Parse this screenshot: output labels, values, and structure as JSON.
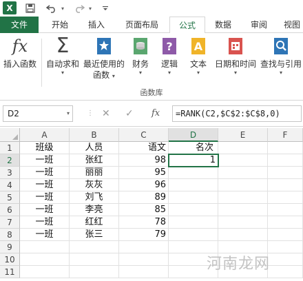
{
  "qat": {
    "undo_icon": "undo-icon",
    "redo_icon": "redo-icon",
    "save_icon": "save-icon"
  },
  "tabs": [
    {
      "label": "文件"
    },
    {
      "label": "开始"
    },
    {
      "label": "插入"
    },
    {
      "label": "页面布局"
    },
    {
      "label": "公式"
    },
    {
      "label": "数据"
    },
    {
      "label": "审阅"
    },
    {
      "label": "视图"
    }
  ],
  "ribbon": {
    "insert_function": {
      "label": "插入函数",
      "icon": "fx-icon"
    },
    "autosum": {
      "label": "自动求和",
      "icon": "sigma-icon"
    },
    "recent": {
      "label1": "最近使用的",
      "label2": "函数",
      "icon": "star-book-icon"
    },
    "finance": {
      "label": "财务",
      "icon": "finance-icon"
    },
    "logic": {
      "label": "逻辑",
      "icon": "logic-icon"
    },
    "text": {
      "label": "文本",
      "icon": "text-icon"
    },
    "datetime": {
      "label": "日期和时间",
      "icon": "calendar-icon"
    },
    "lookup": {
      "label": "查找与引用",
      "icon": "lookup-icon"
    },
    "group_label": "函数库"
  },
  "formula_bar": {
    "name_box": "D2",
    "cancel": "✕",
    "enter": "✓",
    "fx": "fx",
    "formula": "=RANK(C2,$C$2:$C$8,0)"
  },
  "columns": [
    "A",
    "B",
    "C",
    "D",
    "E",
    "F"
  ],
  "rows": [
    "1",
    "2",
    "3",
    "4",
    "5",
    "6",
    "7",
    "8",
    "9",
    "10",
    "11"
  ],
  "table": {
    "header": [
      "班级",
      "人员",
      "语文",
      "名次"
    ],
    "data": [
      [
        "一班",
        "张红",
        "98",
        "1"
      ],
      [
        "一班",
        "丽丽",
        "95",
        ""
      ],
      [
        "一班",
        "灰灰",
        "96",
        ""
      ],
      [
        "一班",
        "刘飞",
        "89",
        ""
      ],
      [
        "一班",
        "李亮",
        "85",
        ""
      ],
      [
        "一班",
        "红红",
        "78",
        ""
      ],
      [
        "一班",
        "张三",
        "79",
        ""
      ]
    ]
  },
  "watermark": "河南龙网"
}
